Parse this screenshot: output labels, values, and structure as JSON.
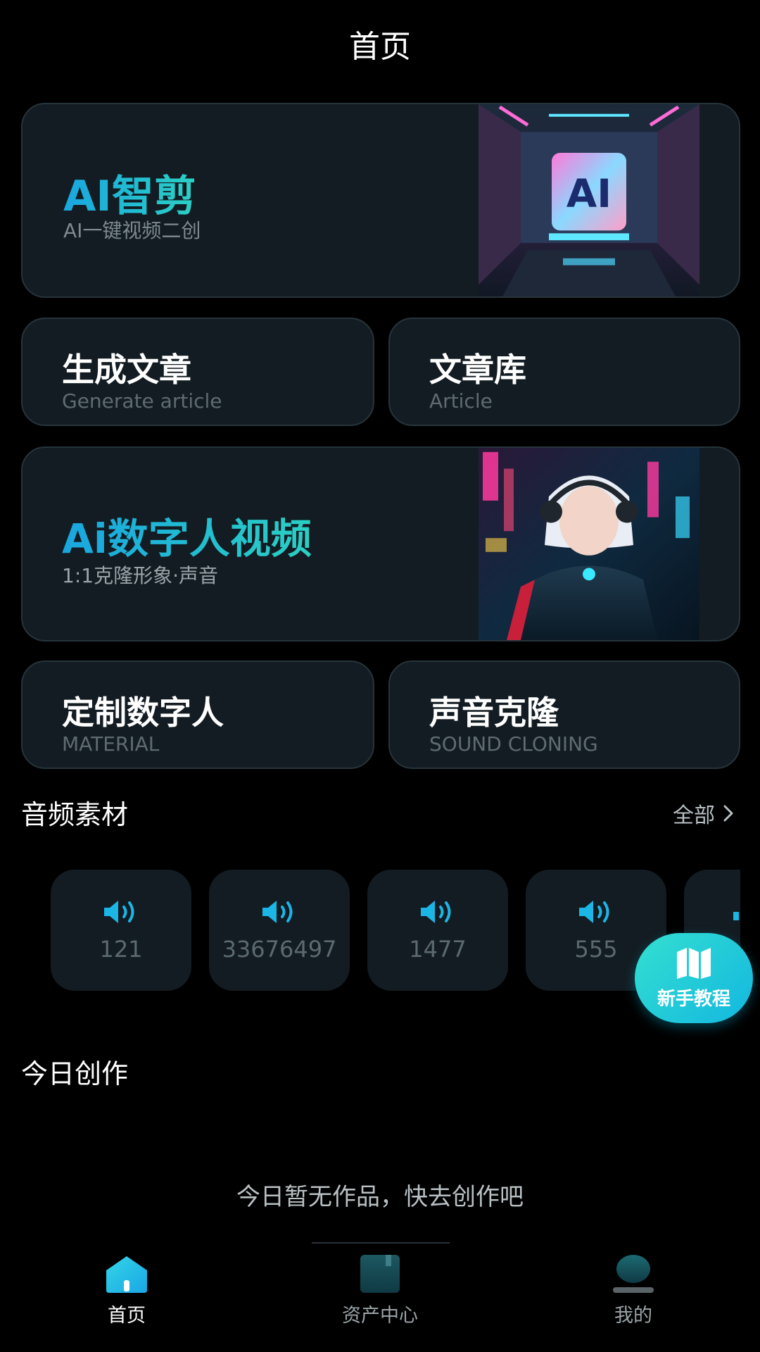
{
  "header": {
    "title": "首页"
  },
  "cards": {
    "ai_clip": {
      "title": "AI智剪",
      "subtitle": "AI一键视频二创",
      "image": "ai-screen-neon-image"
    },
    "generate_article": {
      "title": "生成文章",
      "subtitle": "Generate article"
    },
    "article_library": {
      "title": "文章库",
      "subtitle": "Article"
    },
    "digital_human_video": {
      "title": "Ai数字人视频",
      "subtitle": "1:1克隆形象·声音",
      "image": "cyberpunk-girl-headphones-image"
    },
    "custom_digital_human": {
      "title": "定制数字人",
      "subtitle": "MATERIAL"
    },
    "voice_clone": {
      "title": "声音克隆",
      "subtitle": "SOUND CLONING"
    }
  },
  "audio_section": {
    "title": "音频素材",
    "see_all": "全部",
    "items": [
      {
        "label": "121",
        "icon": "speaker-icon"
      },
      {
        "label": "33676497",
        "icon": "speaker-icon"
      },
      {
        "label": "1477",
        "icon": "speaker-icon"
      },
      {
        "label": "555",
        "icon": "speaker-icon"
      }
    ]
  },
  "fab": {
    "label": "新手教程",
    "icon": "map-icon"
  },
  "today_section": {
    "title": "今日创作",
    "empty_text": "今日暂无作品，快去创作吧"
  },
  "tabs": [
    {
      "label": "首页",
      "icon": "home-icon",
      "active": true
    },
    {
      "label": "资产中心",
      "icon": "folder-icon",
      "active": false
    },
    {
      "label": "我的",
      "icon": "profile-icon",
      "active": false
    }
  ],
  "colors": {
    "background": "#000000",
    "card": "#131c22",
    "accent_start": "#19a6e0",
    "accent_end": "#2bd0c4",
    "muted": "#7e8a90"
  }
}
